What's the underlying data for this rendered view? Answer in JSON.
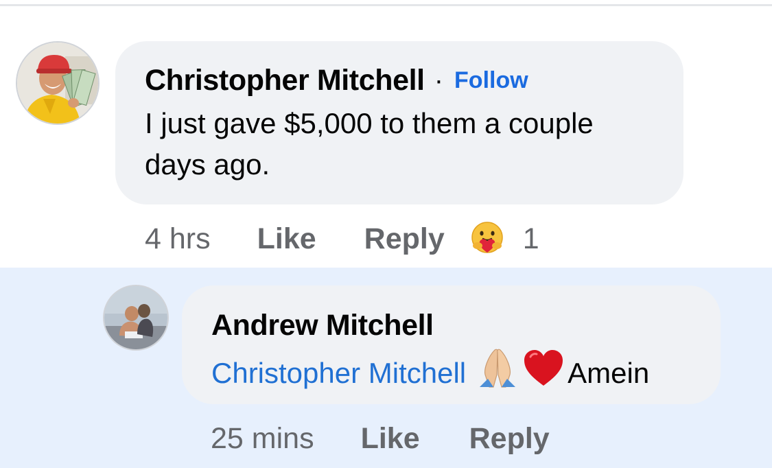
{
  "comment": {
    "author": "Christopher Mitchell",
    "separator": "·",
    "follow_label": "Follow",
    "text_line1": "I just gave $5,000 to them a couple",
    "text_line2": "days ago.",
    "time": "4 hrs",
    "like_label": "Like",
    "reply_label": "Reply",
    "reaction_count": "1",
    "reaction_icon": "care-reaction-icon"
  },
  "reply": {
    "author": "Andrew Mitchell",
    "mention": "Christopher Mitchell",
    "emojis": [
      "folded-hands-icon",
      "red-heart-icon"
    ],
    "text": "Amein",
    "time": "25 mins",
    "like_label": "Like",
    "reply_label": "Reply"
  },
  "colors": {
    "link_blue": "#1b6be0",
    "mention_blue": "#2070d3",
    "bubble_gray": "#f0f2f5",
    "highlight_blue": "#e7f0fd",
    "meta_gray": "#65676b"
  }
}
